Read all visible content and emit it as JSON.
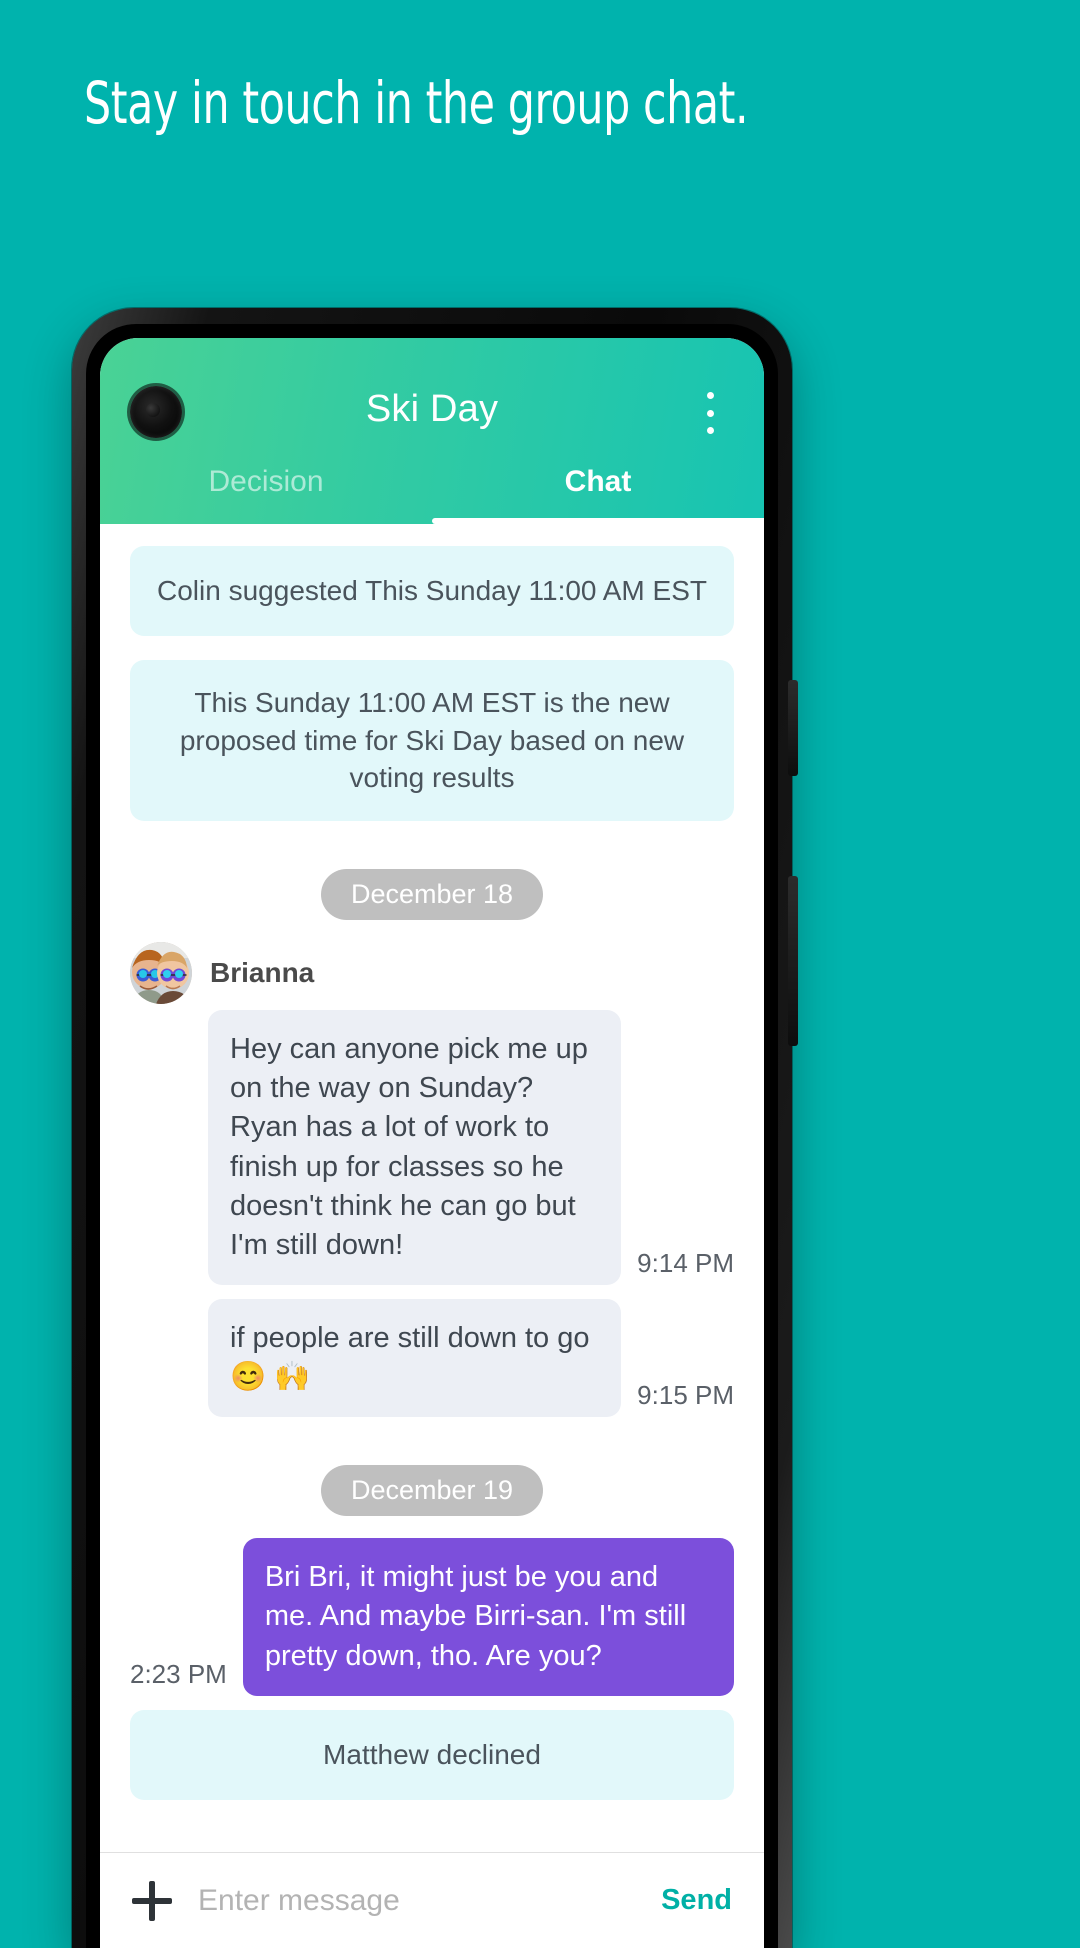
{
  "promo": {
    "headline": "Stay in touch in the group chat.",
    "background_color": "#00b3ad"
  },
  "app_header": {
    "title": "Ski Day",
    "overflow_menu_name": "more-options",
    "gradient_from": "#4ad295",
    "gradient_to": "#17c4b2"
  },
  "tabs": [
    {
      "label": "Decision",
      "active": false
    },
    {
      "label": "Chat",
      "active": true
    }
  ],
  "chat": {
    "system_banners": [
      "Colin suggested This Sunday 11:00 AM EST",
      "This Sunday 11:00 AM EST is the new proposed time for Ski Day based on new voting results"
    ],
    "date_chip_1": "December 18",
    "sender": {
      "name": "Brianna",
      "avatar_name": "brianna-avatar"
    },
    "messages_dec18": [
      {
        "text": "Hey can anyone pick me up on the way on Sunday? Ryan has a lot of work to finish up for classes so he doesn't think he can go but I'm still down!",
        "time": "9:14 PM"
      },
      {
        "text": "if people are still down to go 😊 🙌",
        "time": "9:15 PM"
      }
    ],
    "date_chip_2": "December 19",
    "messages_dec19": [
      {
        "text": "Bri Bri, it might just be you and me. And maybe Birri-san. I'm still pretty down, tho. Are you?",
        "time": "2:23 PM"
      }
    ],
    "trailing_banner": "Matthew declined",
    "bubble_incoming_color": "#eceff5",
    "bubble_outgoing_color": "#7c4fdb",
    "banner_color": "#e2f8fa"
  },
  "input_bar": {
    "add_icon_name": "plus-icon",
    "placeholder": "Enter message",
    "value": "",
    "send_label": "Send",
    "send_color": "#00b0a6"
  }
}
